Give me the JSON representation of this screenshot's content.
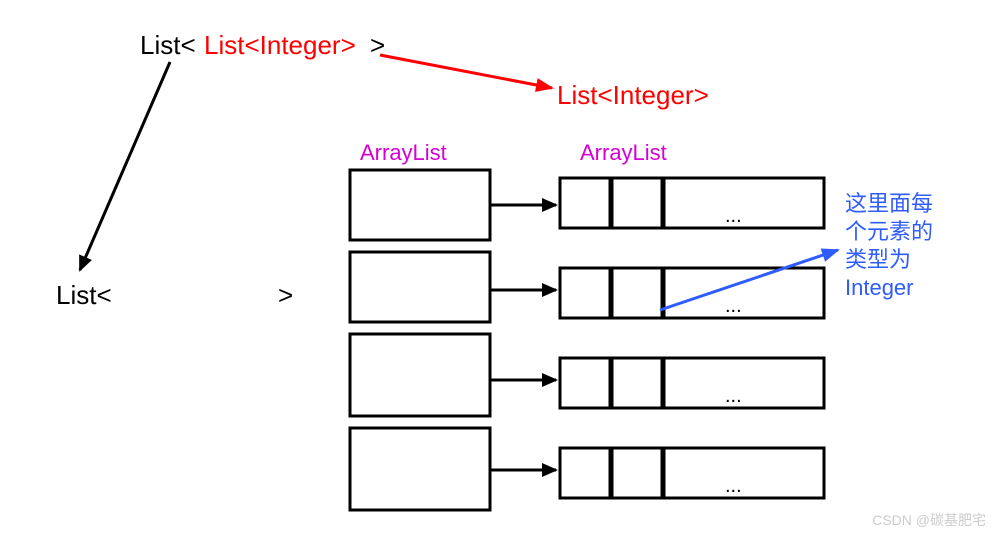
{
  "title": {
    "prefix": "List<",
    "inner": "List<Integer>",
    "suffix": ">"
  },
  "type_label": "List<Integer>",
  "labels": {
    "outer_left": "ArrayList",
    "inner_right": "ArrayList"
  },
  "outer_list": {
    "open": "List<",
    "close": ">"
  },
  "note": {
    "l1": "这里面每",
    "l2": "个元素的",
    "l3": "类型为",
    "l4": "Integer"
  },
  "ellipsis": "...",
  "watermark": "CSDN @碳基肥宅"
}
